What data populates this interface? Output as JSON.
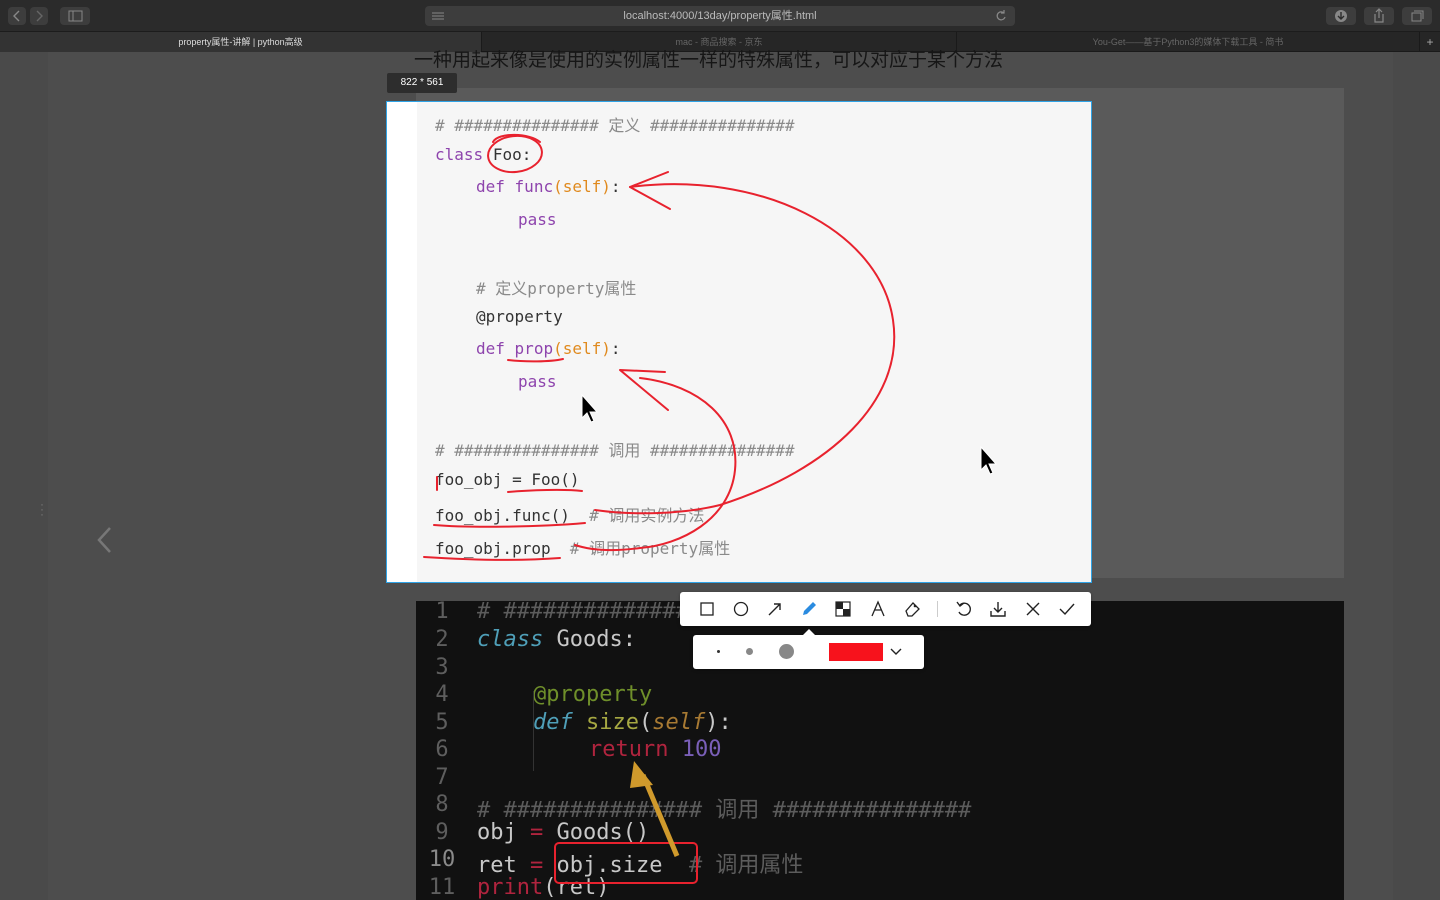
{
  "browser": {
    "url": "localhost:4000/13day/property属性.html",
    "tabs": [
      {
        "label": "property属性-讲解 | python高级",
        "active": true
      },
      {
        "label": "mac - 商品搜索 - 京东",
        "active": false
      },
      {
        "label": "You-Get——基于Python3的媒体下载工具 - 简书",
        "active": false
      }
    ],
    "new_tab_label": "+"
  },
  "page": {
    "heading": "一种用起来像是使用的实例属性一样的特殊属性，可以对应于某个方法"
  },
  "capture": {
    "size_label": "822 * 561",
    "code_lines": [
      "# ############### 定义 ###############",
      "class Foo:",
      "    def func(self):",
      "        pass",
      "",
      "    # 定义property属性",
      "    @property",
      "    def prop(self):",
      "        pass",
      "",
      "# ############### 调用 ###############",
      "foo_obj = Foo()",
      "foo_obj.func()  # 调用实例方法",
      "foo_obj.prop  # 调用property属性"
    ],
    "tokens": {
      "l0": "# ############### 定义 ###############",
      "l1_kw": "class",
      "l1_name": "Foo:",
      "l2_kw": "def",
      "l2_fn": "func",
      "l2_self": "(self)",
      "l2_colon": ":",
      "l3": "pass",
      "l5": "# 定义property属性",
      "l6": "@property",
      "l7_kw": "def",
      "l7_fn": "prop",
      "l7_self": "(self)",
      "l7_colon": ":",
      "l8": "pass",
      "l10": "# ############### 调用 ###############",
      "l11_a": "foo_obj = ",
      "l11_b": "Foo()",
      "l12_a": "foo_obj.func()",
      "l12_c": "# 调用实例方法",
      "l13_a": "foo_obj.prop",
      "l13_c": "# 调用property属性"
    }
  },
  "editor": {
    "line_numbers": [
      "1",
      "2",
      "3",
      "4",
      "5",
      "6",
      "7",
      "8",
      "9",
      "10",
      "11"
    ],
    "current_line": "10",
    "tokens": {
      "l1": "# ###############",
      "l2_kw": "class",
      "l2_name": " Goods:",
      "l4": "@property",
      "l5_kw": "def",
      "l5_fn": " size",
      "l5_p1": "(",
      "l5_self": "self",
      "l5_p2": "):",
      "l6_ret": "return",
      "l6_num": " 100",
      "l8_a": "# ############### 调用 ###############",
      "l9_a": "obj ",
      "l9_op": "=",
      "l9_b": " Goods()",
      "l10_a": "ret ",
      "l10_op": "=",
      "l10_b": " obj.size",
      "l10_c": "  # 调用属性",
      "l11_kw": "print",
      "l11_b": "(ret)"
    }
  },
  "annotation_toolbar": {
    "tools": [
      "rectangle-icon",
      "ellipse-icon",
      "arrow-icon",
      "pen-icon",
      "mosaic-icon",
      "text-icon",
      "eraser-icon",
      "undo-icon",
      "download-icon",
      "close-icon",
      "confirm-icon"
    ],
    "active_tool": "pen-icon",
    "sizes": [
      "small",
      "medium",
      "large"
    ],
    "color": "#f7121c"
  },
  "colors": {
    "annotation_red": "#e8222e",
    "selection_border": "#2fa3e6",
    "arrow_orange": "#d09a2c"
  }
}
